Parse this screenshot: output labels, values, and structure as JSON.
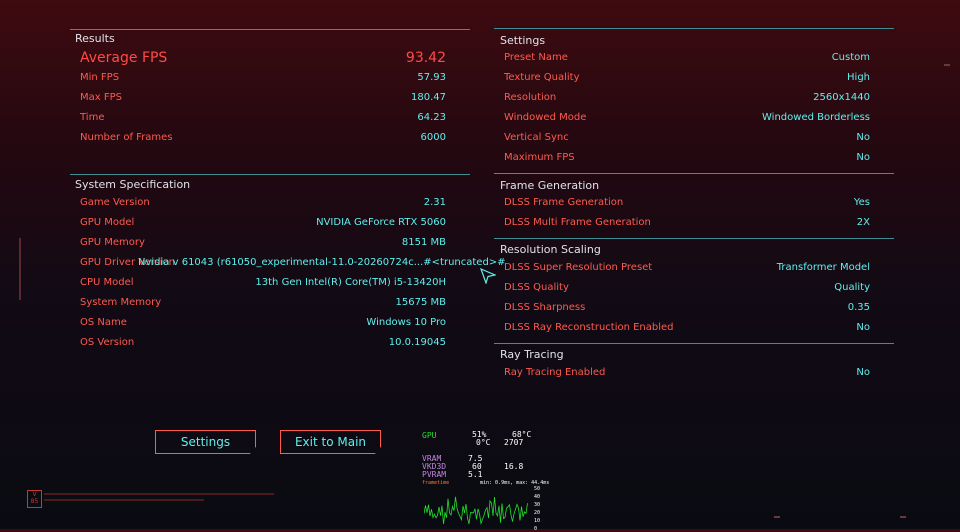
{
  "results": {
    "title": "Results",
    "average_fps_label": "Average FPS",
    "average_fps_value": "93.42",
    "rows": [
      {
        "label": "Min FPS",
        "value": "57.93"
      },
      {
        "label": "Max FPS",
        "value": "180.47"
      },
      {
        "label": "Time",
        "value": "64.23"
      },
      {
        "label": "Number of Frames",
        "value": "6000"
      }
    ]
  },
  "system": {
    "title": "System Specification",
    "rows": [
      {
        "label": "Game Version",
        "value": "2.31"
      },
      {
        "label": "GPU Model",
        "value": "NVIDIA GeForce RTX 5060"
      },
      {
        "label": "GPU Memory",
        "value": "8151 MB"
      },
      {
        "label": "GPU Driver Version",
        "value": "Nvidia v 61043 (r61050_experimental-11.0-20260724c...#<truncated>#"
      },
      {
        "label": "CPU Model",
        "value": "13th Gen Intel(R) Core(TM) i5-13420H"
      },
      {
        "label": "System Memory",
        "value": "15675 MB"
      },
      {
        "label": "OS Name",
        "value": "Windows 10 Pro"
      },
      {
        "label": "OS Version",
        "value": "10.0.19045"
      }
    ]
  },
  "settings": {
    "title": "Settings",
    "rows": [
      {
        "label": "Preset Name",
        "value": "Custom"
      },
      {
        "label": "Texture Quality",
        "value": "High"
      },
      {
        "label": "Resolution",
        "value": "2560x1440"
      },
      {
        "label": "Windowed Mode",
        "value": "Windowed Borderless"
      },
      {
        "label": "Vertical Sync",
        "value": "No"
      },
      {
        "label": "Maximum FPS",
        "value": "No"
      }
    ]
  },
  "frame_generation": {
    "title": "Frame Generation",
    "rows": [
      {
        "label": "DLSS Frame Generation",
        "value": "Yes"
      },
      {
        "label": "DLSS Multi Frame Generation",
        "value": "2X"
      }
    ]
  },
  "resolution_scaling": {
    "title": "Resolution Scaling",
    "rows": [
      {
        "label": "DLSS Super Resolution Preset",
        "value": "Transformer Model"
      },
      {
        "label": "DLSS Quality",
        "value": "Quality"
      },
      {
        "label": "DLSS Sharpness",
        "value": "0.35"
      },
      {
        "label": "DLSS Ray Reconstruction Enabled",
        "value": "No"
      }
    ]
  },
  "ray_tracing": {
    "title": "Ray Tracing",
    "rows": [
      {
        "label": "Ray Tracing Enabled",
        "value": "No"
      }
    ]
  },
  "buttons": {
    "settings": "Settings",
    "exit": "Exit to Main Menu"
  },
  "perf_overlay": {
    "gpu_label": "GPU",
    "gpu_usage": "51%",
    "gpu_temp": "68°C",
    "gpu_temp2": "0°C",
    "gpu_clock": "2707",
    "vram_label": "VRAM",
    "vram_value": "7.5",
    "vkd3d_label": "VKD3D",
    "fps_value": "60",
    "frametime_value": "16.8",
    "pvram_label": "PVRAM",
    "pvram_value": "5.1",
    "frametime_label": "frametime",
    "frametime_range": "min: 0.9ms, max: 44.4ms",
    "axis_ticks": [
      "50",
      "40",
      "30",
      "20",
      "10",
      "0"
    ]
  },
  "colors": {
    "label": "#ff5a4e",
    "value": "#5ff0ee",
    "separator": "#3f8e93",
    "title": "#dfe2ea",
    "graph": "#22e02a"
  }
}
